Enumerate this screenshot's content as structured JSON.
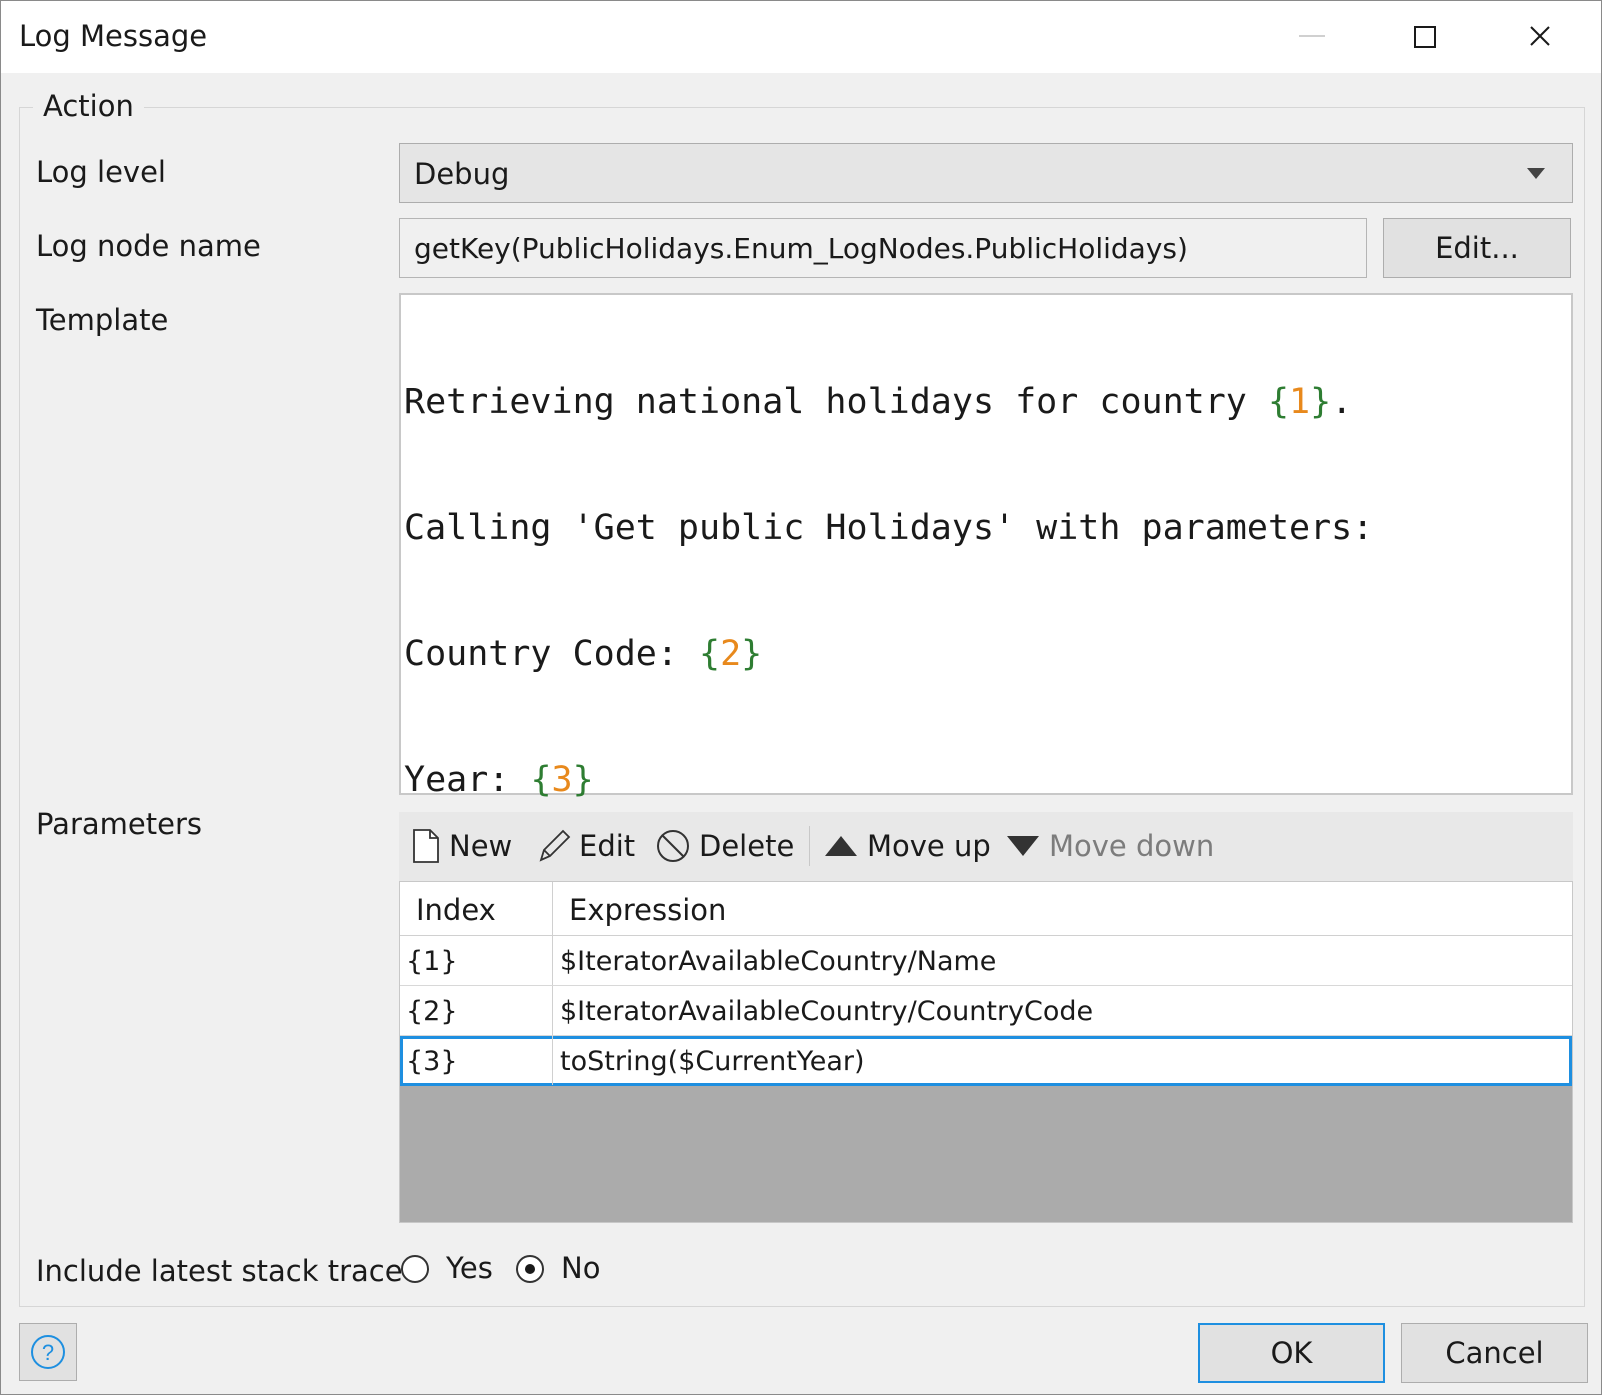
{
  "window": {
    "title": "Log Message",
    "minimize_icon": "minimize-icon",
    "maximize_icon": "maximize-icon",
    "close_icon": "close-icon"
  },
  "action": {
    "group_title": "Action",
    "log_level": {
      "label": "Log level",
      "value": "Debug",
      "icon": "chevron-down-icon"
    },
    "log_node_name": {
      "label": "Log node name",
      "value": "getKey(PublicHolidays.Enum_LogNodes.PublicHolidays)",
      "edit_label": "Edit..."
    },
    "template": {
      "label": "Template",
      "lines": [
        {
          "text": "Retrieving national holidays for country ",
          "param": "1",
          "suffix": "."
        },
        {
          "text": "Calling 'Get public Holidays' with parameters:",
          "param": "",
          "suffix": ""
        },
        {
          "text": "Country Code: ",
          "param": "2",
          "suffix": ""
        },
        {
          "text": "Year: ",
          "param": "3",
          "suffix": ""
        }
      ],
      "open_brace": "{",
      "close_brace": "}"
    },
    "parameters": {
      "label": "Parameters",
      "toolbar": {
        "new": {
          "label": "New",
          "icon": "new-document-icon",
          "enabled": true
        },
        "edit": {
          "label": "Edit",
          "icon": "pencil-icon",
          "enabled": true
        },
        "delete": {
          "label": "Delete",
          "icon": "prohibited-icon",
          "enabled": true
        },
        "move_up": {
          "label": "Move up",
          "icon": "triangle-up-icon",
          "enabled": true
        },
        "move_down": {
          "label": "Move down",
          "icon": "triangle-down-icon",
          "enabled": false
        }
      },
      "columns": [
        "Index",
        "Expression"
      ],
      "rows": [
        {
          "index": "{1}",
          "expression": "$IteratorAvailableCountry/Name"
        },
        {
          "index": "{2}",
          "expression": "$IteratorAvailableCountry/CountryCode"
        },
        {
          "index": "{3}",
          "expression": "toString($CurrentYear)"
        }
      ],
      "selected_row": 2
    },
    "stack_trace": {
      "label": "Include latest stack trace",
      "options": [
        "Yes",
        "No"
      ],
      "selected": "No"
    }
  },
  "footer": {
    "help_icon": "help-icon",
    "ok_label": "OK",
    "cancel_label": "Cancel"
  },
  "colors": {
    "accent": "#1e8fe0",
    "brace": "#2e7d32",
    "param_number": "#e8891c",
    "grid_empty": "#ababab"
  }
}
